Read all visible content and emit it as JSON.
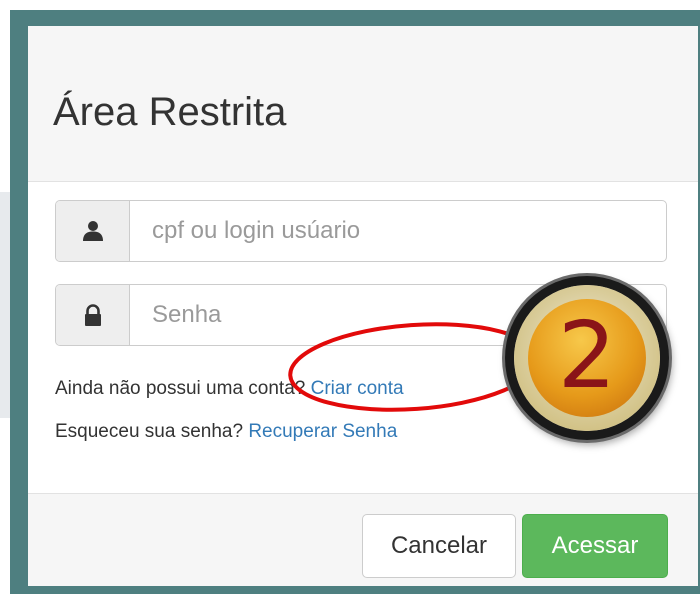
{
  "modal": {
    "title": "Área Restrita"
  },
  "login": {
    "placeholder": "cpf ou login usúario",
    "icon": "user-icon"
  },
  "password": {
    "placeholder": "Senha",
    "icon": "lock-icon"
  },
  "signup": {
    "prompt": "Ainda não possui uma conta?",
    "link": "Criar conta"
  },
  "recover": {
    "prompt": "Esqueceu sua senha?",
    "link": "Recuperar Senha"
  },
  "footer": {
    "cancel_label": "Cancelar",
    "submit_label": "Acessar"
  },
  "annotation": {
    "step_number": "2"
  },
  "colors": {
    "modal_frame": "#4e7f80",
    "link": "#337ab7",
    "primary_button": "#5cb85c",
    "highlight_ellipse": "#e20a0a",
    "badge_number": "#8a1418"
  }
}
